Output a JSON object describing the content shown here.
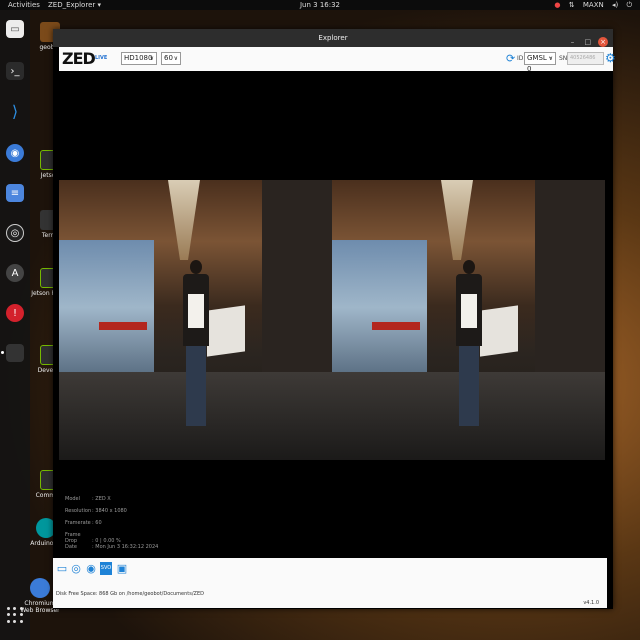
{
  "topbar": {
    "activities": "Activities",
    "app_menu": "ZED_Explorer",
    "clock": "Jun 3  16:32",
    "tray_items": [
      "MAXN"
    ]
  },
  "dock": {
    "icons": [
      "files-icon",
      "terminal-icon",
      "vscode-icon",
      "chromium-icon",
      "text-editor-icon",
      "obs-icon",
      "app-store-icon",
      "help-icon",
      "zed-explorer-icon"
    ]
  },
  "desktop": {
    "labels": {
      "geobot": "geobot",
      "jetson": "Jetson",
      "terminal": "Termi",
      "jetson_portal": "Jetson Portal",
      "developer": "Develop",
      "community": "Communi",
      "arduino": "Arduino ID",
      "chromium": "Chromium Web Browser"
    }
  },
  "window": {
    "title": "Explorer",
    "logo": "ZED",
    "live_badge": "LIVE",
    "resolution": "HD1080",
    "fps": "60",
    "id_label": "ID",
    "camera_id": "GMSL - 0",
    "sn_label": "SN",
    "sn_value": "40526486"
  },
  "camera_info": {
    "model_label": "Model",
    "model_value": "ZED X",
    "resolution_label": "Resolution",
    "resolution_value": "3840 x 1080",
    "framerate_label": "Framerate",
    "framerate_value": "60",
    "frame_drop_label": "Frame Drop",
    "frame_drop_value": "0  |  0.00 %",
    "date_label": "Date",
    "date_value": "Mon Jun 3 16:32:12 2024"
  },
  "action_icons": [
    "folder-icon",
    "broadcast-icon",
    "record-icon",
    "svo-icon",
    "camera-snapshot-icon"
  ],
  "status": {
    "disk": "Disk Free Space: 868 Gb   on /home/geobot/Documents/ZED",
    "version": "v4.1.0"
  },
  "colors": {
    "accent": "#1e82d6",
    "close": "#e2553b"
  }
}
